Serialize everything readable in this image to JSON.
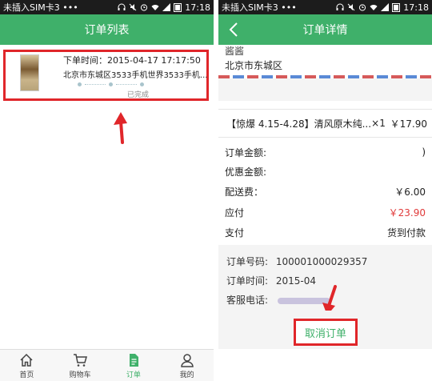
{
  "left": {
    "status_bar": {
      "carrier": "未插入SIM卡3 •••",
      "time": "17:18"
    },
    "nav_title": "订单列表",
    "order": {
      "time_label": "下单时间：2015-04-17 17:17:50",
      "address": "北京市东城区3533手机世界3533手机...",
      "status": "已完成"
    },
    "tabs": [
      {
        "label": "首页",
        "icon": "home-icon"
      },
      {
        "label": "购物车",
        "icon": "cart-icon"
      },
      {
        "label": "订单",
        "icon": "order-icon"
      },
      {
        "label": "我的",
        "icon": "user-icon"
      }
    ],
    "active_tab": "订单"
  },
  "right": {
    "status_bar": {
      "carrier": "未插入SIM卡3 •••",
      "time": "17:18"
    },
    "nav_title": "订单详情",
    "recipient_name": "酱酱",
    "city": "北京市东城区",
    "item": {
      "name": "【惊爆 4.15-4.28】清风原木纯...",
      "qty": "×1",
      "price": "￥17.90"
    },
    "fees": [
      {
        "label": "订单金额:",
        "value": ")"
      },
      {
        "label": "优惠金额:",
        "value": ""
      },
      {
        "label": "配送费：",
        "value": "￥6.00"
      },
      {
        "label": "应付",
        "value": "￥23.90",
        "red": true
      },
      {
        "label": "支付",
        "value": "货到付款"
      }
    ],
    "info": {
      "order_no_label": "订单号码:",
      "order_no_value": "100001000029357",
      "order_time_label": "订单时间:",
      "order_time_value": "2015-04",
      "service_label": "客服电话:"
    },
    "cancel_label": "取消订单"
  },
  "colors": {
    "green": "#3fb06a",
    "highlight": "#e0262a",
    "price_red": "#e03a3a"
  }
}
